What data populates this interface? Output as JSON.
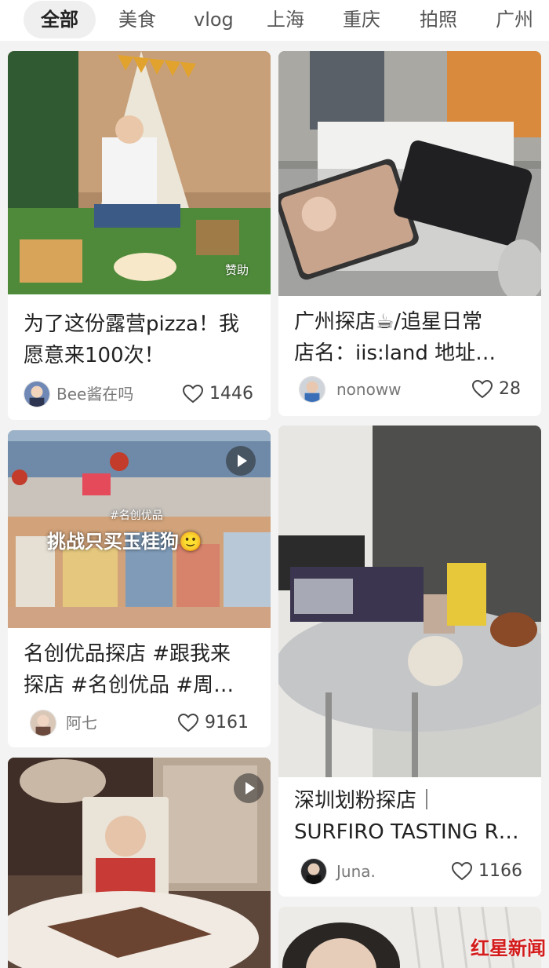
{
  "tabs": [
    "全部",
    "美食",
    "vlog",
    "上海",
    "重庆",
    "拍照",
    "广州"
  ],
  "cards": [
    {
      "title_line1": "为了这份露营pizza！我",
      "title_line2": "愿意来100次！",
      "author": "Bee酱在吗",
      "likes": "1446",
      "badge": "赞助"
    },
    {
      "title_line1": "广州探店☕/追星日常",
      "title_line2": "店名：iis:land 地址…",
      "author": "nonoww",
      "likes": "28"
    },
    {
      "title_line1": "名创优品探店 #跟我来",
      "title_line2": "探店 #名创优品 #周…",
      "author": "阿七",
      "likes": "9161",
      "overlay_text": "挑战只买玉桂狗🙂",
      "overlay_tag": "#名创优品"
    },
    {
      "title_line1": "深圳划粉探店｜",
      "title_line2": "SURFIRO TASTING R…",
      "author": "Juna.",
      "likes": "1166"
    }
  ],
  "watermark": "红星新闻",
  "colors": {
    "tab_active_bg": "#efefef",
    "heart": "#444444",
    "watermark": "#d41b1b"
  }
}
